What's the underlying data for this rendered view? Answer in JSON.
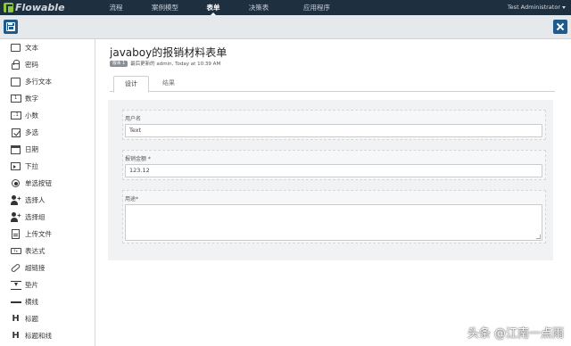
{
  "app": {
    "logo_text": "Flowable"
  },
  "nav": {
    "items": [
      {
        "label": "流程"
      },
      {
        "label": "案例模型"
      },
      {
        "label": "表单",
        "active": true
      },
      {
        "label": "决策表"
      },
      {
        "label": "应用程序"
      }
    ],
    "user": "Test Administrator"
  },
  "toolbar": {
    "save_icon": "save-icon",
    "close_icon": "close-icon",
    "accent": "#1e5a8c"
  },
  "palette": {
    "items": [
      {
        "label": "文本",
        "icon": "text-field-icon"
      },
      {
        "label": "密码",
        "icon": "lock-icon"
      },
      {
        "label": "多行文本",
        "icon": "multiline-text-icon"
      },
      {
        "label": "数字",
        "icon": "number-icon"
      },
      {
        "label": "小数",
        "icon": "decimal-icon"
      },
      {
        "label": "多选",
        "icon": "checkbox-icon"
      },
      {
        "label": "日期",
        "icon": "calendar-icon"
      },
      {
        "label": "下拉",
        "icon": "dropdown-icon"
      },
      {
        "label": "单选按钮",
        "icon": "radio-icon"
      },
      {
        "label": "选择人",
        "icon": "person-add-icon"
      },
      {
        "label": "选择组",
        "icon": "group-add-icon"
      },
      {
        "label": "上传文件",
        "icon": "upload-file-icon"
      },
      {
        "label": "表达式",
        "icon": "expression-icon"
      },
      {
        "label": "超链接",
        "icon": "link-icon"
      },
      {
        "label": "垫片",
        "icon": "spacer-icon"
      },
      {
        "label": "横线",
        "icon": "horizontal-line-icon"
      },
      {
        "label": "标题",
        "icon": "heading-icon"
      },
      {
        "label": "标题和线",
        "icon": "heading-line-icon"
      }
    ]
  },
  "form": {
    "title": "javaboy的报销材料表单",
    "version_badge": "版本 1",
    "meta": "最后更新的 admin, Today at 10:39 AM",
    "tabs": [
      {
        "label": "设计",
        "active": true
      },
      {
        "label": "结果"
      }
    ],
    "fields": [
      {
        "label": "用户名",
        "value": "Text"
      },
      {
        "label": "报销金额 *",
        "value": "123.12"
      },
      {
        "label": "用途*",
        "value": ""
      }
    ]
  },
  "watermark": "头条 @江南一点雨"
}
